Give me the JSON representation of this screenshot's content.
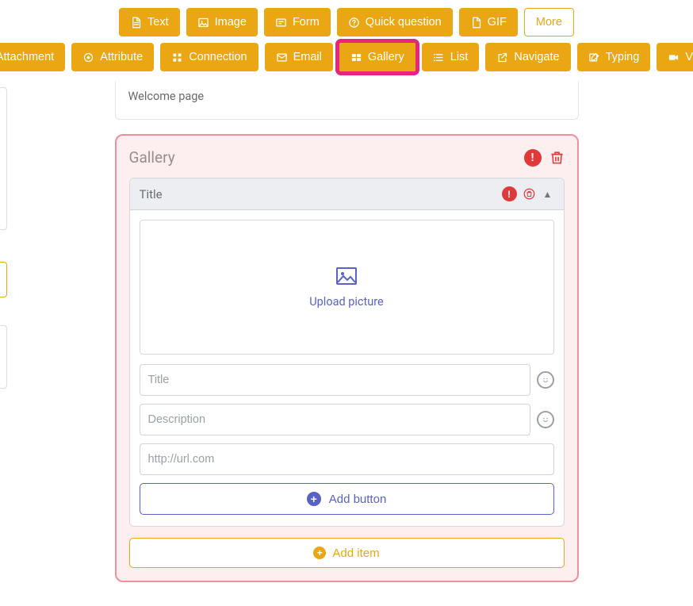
{
  "colors": {
    "accent": "#eaa613",
    "danger": "#df3a3a",
    "primary": "#5a62c4",
    "highlight_ring": "#e8247c"
  },
  "toolbar": {
    "row1": {
      "text": "Text",
      "image": "Image",
      "form": "Form",
      "quick_question": "Quick question",
      "gif": "GIF",
      "more": "More"
    },
    "row2": {
      "attachment": "Attachment",
      "attribute": "Attribute",
      "connection": "Connection",
      "email": "Email",
      "gallery": "Gallery",
      "list": "List",
      "navigate": "Navigate",
      "typing": "Typing",
      "video": "Video"
    },
    "highlighted": "gallery"
  },
  "welcome": {
    "text": "Welcome page"
  },
  "gallery": {
    "block_title": "Gallery",
    "item_head": "Title",
    "upload_label": "Upload picture",
    "title_placeholder": "Title",
    "description_placeholder": "Description",
    "url_placeholder": "http://url.com",
    "add_button_label": "Add button",
    "add_item_label": "Add item"
  }
}
